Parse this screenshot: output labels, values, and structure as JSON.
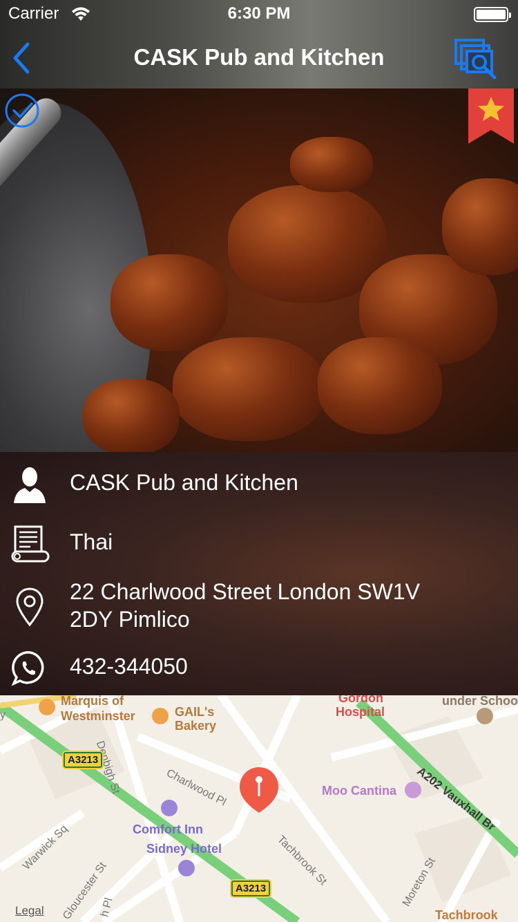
{
  "status_bar": {
    "carrier": "Carrier",
    "time": "6:30 PM"
  },
  "nav": {
    "title": "CASK Pub and Kitchen",
    "back_icon": "chevron-left-icon",
    "gallery_icon": "gallery-search-icon",
    "accent": "#1a7aef"
  },
  "hero": {
    "favorite_color": "#e2413b",
    "star_color": "#f6c033"
  },
  "info": {
    "name": "CASK Pub and Kitchen",
    "cuisine": "Thai",
    "address_line1": "22 Charlwood Street London SW1V",
    "address_line2": "2DY Pimlico",
    "phone": "432-344050"
  },
  "map": {
    "labels": {
      "marquis": "Marquis of",
      "westminster": "Westminster",
      "gails": "GAIL's",
      "bakery": "Bakery",
      "gordon": "Gordon",
      "hospital": "Hospital",
      "school": "under Schoo",
      "moo": "Moo Cantina",
      "comfort": "Comfort Inn",
      "sidney": "Sidney Hotel",
      "tachbrook": "Tachbrook"
    },
    "streets": {
      "denbigh": "Denbigh St",
      "charlwood": "Charlwood Pl",
      "warwick": "Warwick Sq",
      "gloucester": "Gloucester St",
      "tachbrook_st": "Tachbrook St",
      "moreton": "Moreton St",
      "vauxhall": "A202 Vauxhall Br",
      "pl": "h Pl",
      "y": "y"
    },
    "road_badge_1": "A3213",
    "road_badge_2": "A3213",
    "legal": "Legal"
  }
}
